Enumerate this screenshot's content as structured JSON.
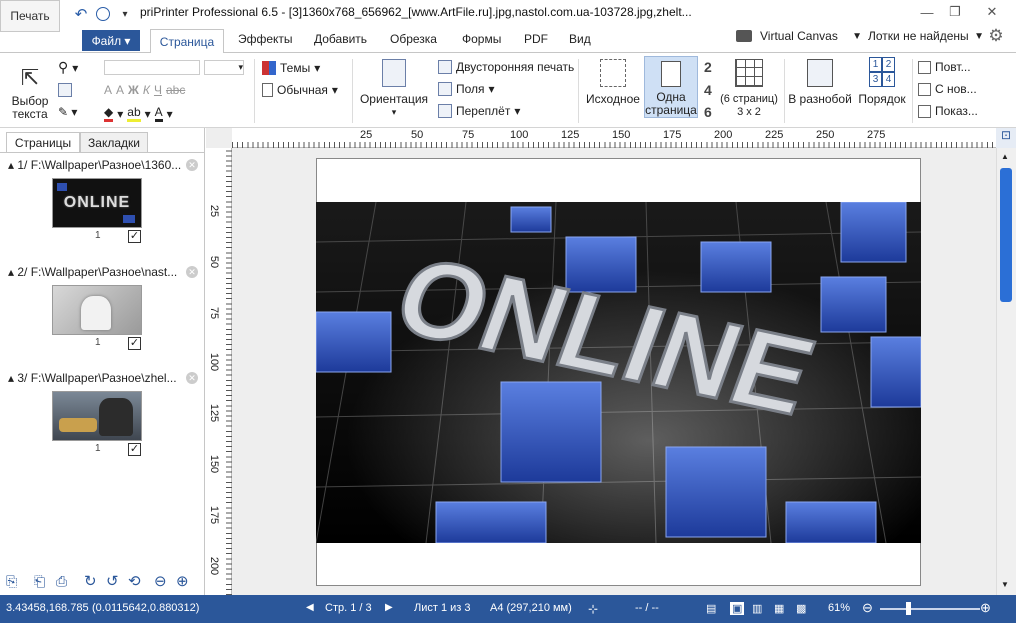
{
  "quick_access": {
    "print_label": "Печать"
  },
  "window": {
    "title": "priPrinter Professional 6.5 - [3]1360x768_656962_[www.ArtFile.ru].jpg,nastol.com.ua-103728.jpg,zhelt..."
  },
  "tabs": {
    "file": "Файл",
    "items": [
      "Страница",
      "Эффекты",
      "Добавить",
      "Обрезка",
      "Формы",
      "PDF",
      "Вид"
    ],
    "active": "Страница"
  },
  "printer": {
    "canvas": "Virtual Canvas",
    "trays": "Лотки не найдены"
  },
  "ribbon": {
    "select_text": "Выбор текста",
    "themes": "Темы",
    "style": "Обычная",
    "orientation": "Ориентация",
    "duplex": "Двусторонняя печать",
    "margins": "Поля",
    "binding": "Переплёт",
    "original": "Исходное",
    "one_page": "Одна страница",
    "pages_per_sheet": "(6 страниц) 3 x 2",
    "scatter": "В разнобой",
    "order": "Порядок",
    "n2": "2",
    "n4": "4",
    "n6": "6",
    "order_grid": [
      "1",
      "2",
      "3",
      "4"
    ],
    "repeat": "Повт...",
    "new": "С нов...",
    "show": "Показ...",
    "font_buttons": [
      "Ж",
      "К",
      "Ч",
      "abc"
    ]
  },
  "panel": {
    "tab_pages": "Страницы",
    "tab_bookmarks": "Закладки",
    "items": [
      {
        "title": "1/ F:\\Wallpaper\\Разное\\1360...",
        "page": "1",
        "checked": "✓"
      },
      {
        "title": "2/ F:\\Wallpaper\\Разное\\nast...",
        "page": "1",
        "checked": "✓"
      },
      {
        "title": "3/ F:\\Wallpaper\\Разное\\zhel...",
        "page": "1",
        "checked": "✓"
      }
    ],
    "thumb1_text": "ONLINE"
  },
  "ruler": {
    "h_ticks": [
      "25",
      "50",
      "75",
      "100",
      "125",
      "150",
      "175",
      "200",
      "225",
      "250",
      "275"
    ],
    "v_ticks": [
      "25",
      "50",
      "75",
      "100",
      "125",
      "150",
      "175",
      "200"
    ]
  },
  "image": {
    "text": "ONLINE"
  },
  "status": {
    "coords": "3.43458,168.785",
    "norm_coords": "(0.0115642,0.880312)",
    "page": "Стр. 1 / 3",
    "sheet": "Лист 1 из 3",
    "format": "A4 (297,210 мм)",
    "dashes": "-- / --",
    "zoom": "61%"
  },
  "colors": {
    "accent": "#2b579a",
    "cube": "#2e4fb0",
    "floor": "#111111"
  }
}
